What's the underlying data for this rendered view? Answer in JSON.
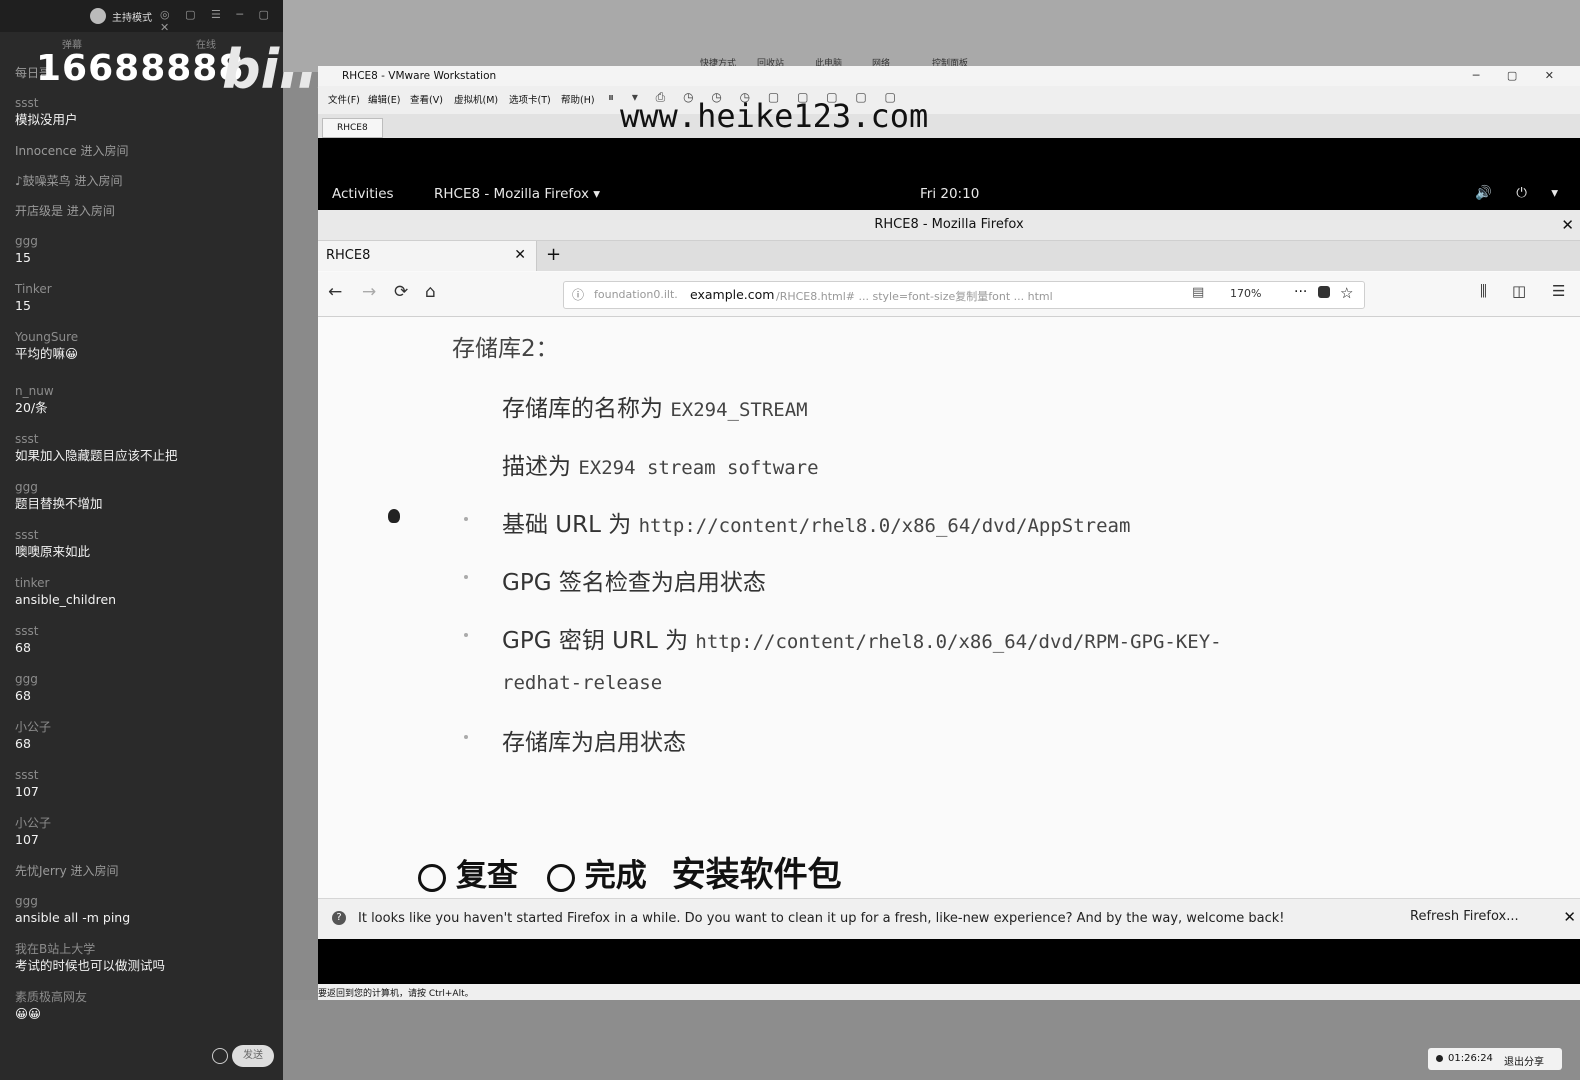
{
  "chat": {
    "mode_label": "主持模式",
    "window_controls": "◎ ▢ ☰ ─ ▢ ✕",
    "tab_left": "弹幕",
    "tab_right": "在线",
    "room_id": "16688888",
    "logo_text": "bilibili",
    "messages": [
      {
        "user": "每日哥",
        "text": ""
      },
      {
        "user": "ssst",
        "text": "模拟没用户"
      },
      {
        "user": "Innocence 进入房间",
        "text": ""
      },
      {
        "user": "♪鼓噪菜鸟 进入房间",
        "text": ""
      },
      {
        "user": "开店级是 进入房间",
        "text": ""
      },
      {
        "user": "ggg",
        "text": "15"
      },
      {
        "user": "Tinker",
        "text": "15"
      },
      {
        "user": "YoungSure",
        "text": "平均的嘛😀"
      },
      {
        "user": "n_nuw",
        "text": "20/条"
      },
      {
        "user": "ssst",
        "text": "如果加入隐藏题目应该不止把"
      },
      {
        "user": "ggg",
        "text": "题目替换不增加"
      },
      {
        "user": "ssst",
        "text": "噢噢原来如此"
      },
      {
        "user": "tinker",
        "text": "ansible_children"
      },
      {
        "user": "ssst",
        "text": "68"
      },
      {
        "user": "ggg",
        "text": "68"
      },
      {
        "user": "小公子",
        "text": "68"
      },
      {
        "user": "ssst",
        "text": "107"
      },
      {
        "user": "小公子",
        "text": "107"
      },
      {
        "user": "先忧Jerry 进入房间",
        "text": ""
      },
      {
        "user": "ggg",
        "text": "ansible all -m ping"
      },
      {
        "user": "我在B站上大学",
        "text": "考试的时候也可以做测试吗"
      },
      {
        "user": "素质极高网友",
        "text": "😀😀"
      }
    ],
    "send_label": "发送"
  },
  "desktop_icons": [
    "快捷方式",
    "回收站",
    "此电脑",
    "网络",
    "控制面板"
  ],
  "vmware": {
    "title": "RHCE8 - VMware Workstation",
    "window_controls": "─ ▢ ✕",
    "menu": [
      "文件(F)",
      "编辑(E)",
      "查看(V)",
      "虚拟机(M)",
      "选项卡(T)",
      "帮助(H)"
    ],
    "toolbar_icons": "⏸ ▾ ⎙ ◷ ◷ ◷ ▢ ▢ ▢ ▢ ▢",
    "vm_tab": "RHCE8",
    "status_text": "要返回到您的计算机，请按 Ctrl+Alt。"
  },
  "watermark": "www.heike123.com",
  "gnome": {
    "activities": "Activities",
    "app_menu": "RHCE8 - Mozilla Firefox ▾",
    "clock": "Fri 20:10",
    "sys_icons": "🔊 ⏻ ▾"
  },
  "firefox": {
    "window_title": "RHCE8 - Mozilla Firefox",
    "tab_label": "RHCE8",
    "url_prefix": "foundation0.ilt.",
    "url_host": "example.com",
    "url_path": "/RHCE8.html# ... style=font-size复制量font ... html",
    "zoom": "170%",
    "notification": "It looks like you haven't started Firefox in a while. Do you want to clean it up for a fresh, like-new experience? And by the way, welcome back!",
    "refresh_button": "Refresh Firefox..."
  },
  "page": {
    "heading": "存储库2：",
    "items": [
      {
        "label": "存储库的名称为 ",
        "code": "EX294_STREAM"
      },
      {
        "label": "描述为 ",
        "code": "EX294 stream software"
      },
      {
        "label": "基础 URL 为 ",
        "code": "http://content/rhel8.0/x86_64/dvd/AppStream"
      },
      {
        "label": "GPG 签名检查为启用状态",
        "code": ""
      },
      {
        "label": "GPG 密钥 URL 为 ",
        "code": "http://content/rhel8.0/x86_64/dvd/RPM-GPG-KEY-"
      },
      {
        "label": "",
        "code": "redhat-release"
      },
      {
        "label": "存储库为启用状态",
        "code": ""
      }
    ],
    "step_review": "复查",
    "step_done": "完成",
    "step_title": "安装软件包"
  },
  "timer": {
    "time": "01:26:24",
    "exit_label": "退出分享"
  }
}
